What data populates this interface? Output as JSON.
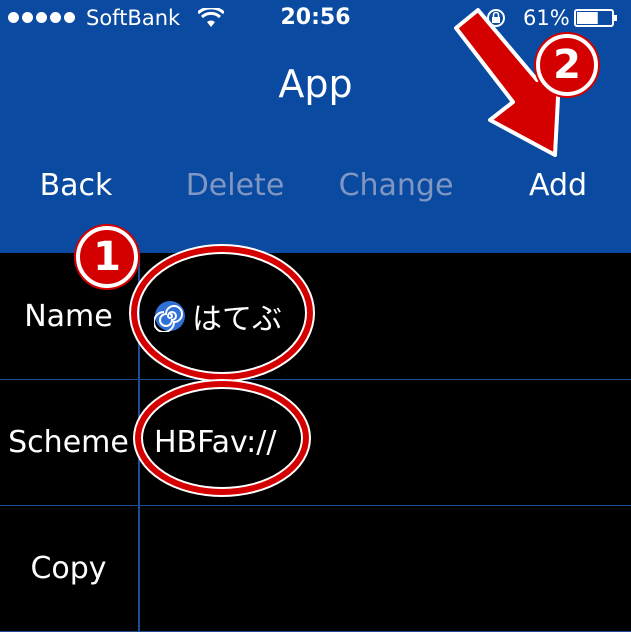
{
  "status_bar": {
    "carrier": "SoftBank",
    "time": "20:56",
    "battery_percent": "61%",
    "battery_level": 0.61
  },
  "nav": {
    "title": "App"
  },
  "toolbar": {
    "back": "Back",
    "delete": "Delete",
    "change": "Change",
    "add": "Add"
  },
  "form": {
    "rows": [
      {
        "label": "Name",
        "value": "はてぶ",
        "icon": "hatena-swirl-icon"
      },
      {
        "label": "Scheme",
        "value": "HBFav://"
      },
      {
        "label": "Copy",
        "value": ""
      }
    ]
  },
  "annotations": {
    "badge_1": "1",
    "badge_2": "2"
  },
  "colors": {
    "header": "#0a4aa0",
    "grid": "#1f4c93",
    "annotation": "#d40000",
    "disabled": "#7f97c2"
  }
}
